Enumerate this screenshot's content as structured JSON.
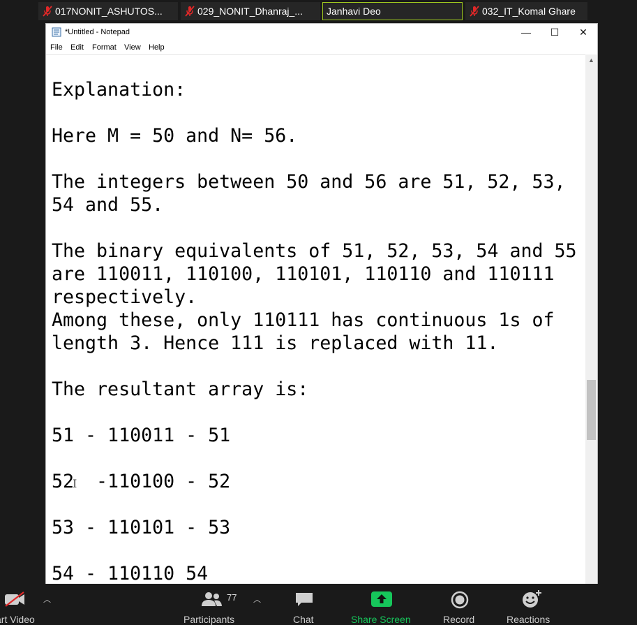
{
  "participants": [
    {
      "name": "017NONIT_ASHUTOS...",
      "muted": true
    },
    {
      "name": "029_NONIT_Dhanraj_...",
      "muted": true
    },
    {
      "name": "Janhavi Deo",
      "muted": false,
      "active": true
    },
    {
      "name": "032_IT_Komal Ghare",
      "muted": true
    }
  ],
  "window": {
    "title": "*Untitled - Notepad",
    "minimize": "—",
    "maximize": "☐",
    "close": "✕"
  },
  "menu": [
    "File",
    "Edit",
    "Format",
    "View",
    "Help"
  ],
  "editor_lines": [
    "Explanation:",
    "",
    "Here M = 50 and N= 56.",
    "",
    "The integers between 50 and 56 are 51, 52, 53,",
    "54 and 55.",
    "",
    "The binary equivalents of 51, 52, 53, 54 and 55",
    "are 110011, 110100, 110101, 110110 and 110111",
    "respectively.",
    "Among these, only 110111 has continuous 1s of",
    "length 3. Hence 111 is replaced with 11.",
    "",
    "The resultant array is:",
    "",
    "51 - 110011 - 51",
    "",
    "52  -110100 - 52",
    "",
    "53 - 110101 - 53",
    "",
    "54 - 110110 54"
  ],
  "caret_glyph": "I",
  "toolbar": {
    "video_label": "art Video",
    "participants_label": "Participants",
    "participants_count": "77",
    "chat_label": "Chat",
    "share_label": "Share Screen",
    "record_label": "Record",
    "reactions_label": "Reactions",
    "share_color": "#16c65b",
    "label_color": "#cfcfcf"
  }
}
